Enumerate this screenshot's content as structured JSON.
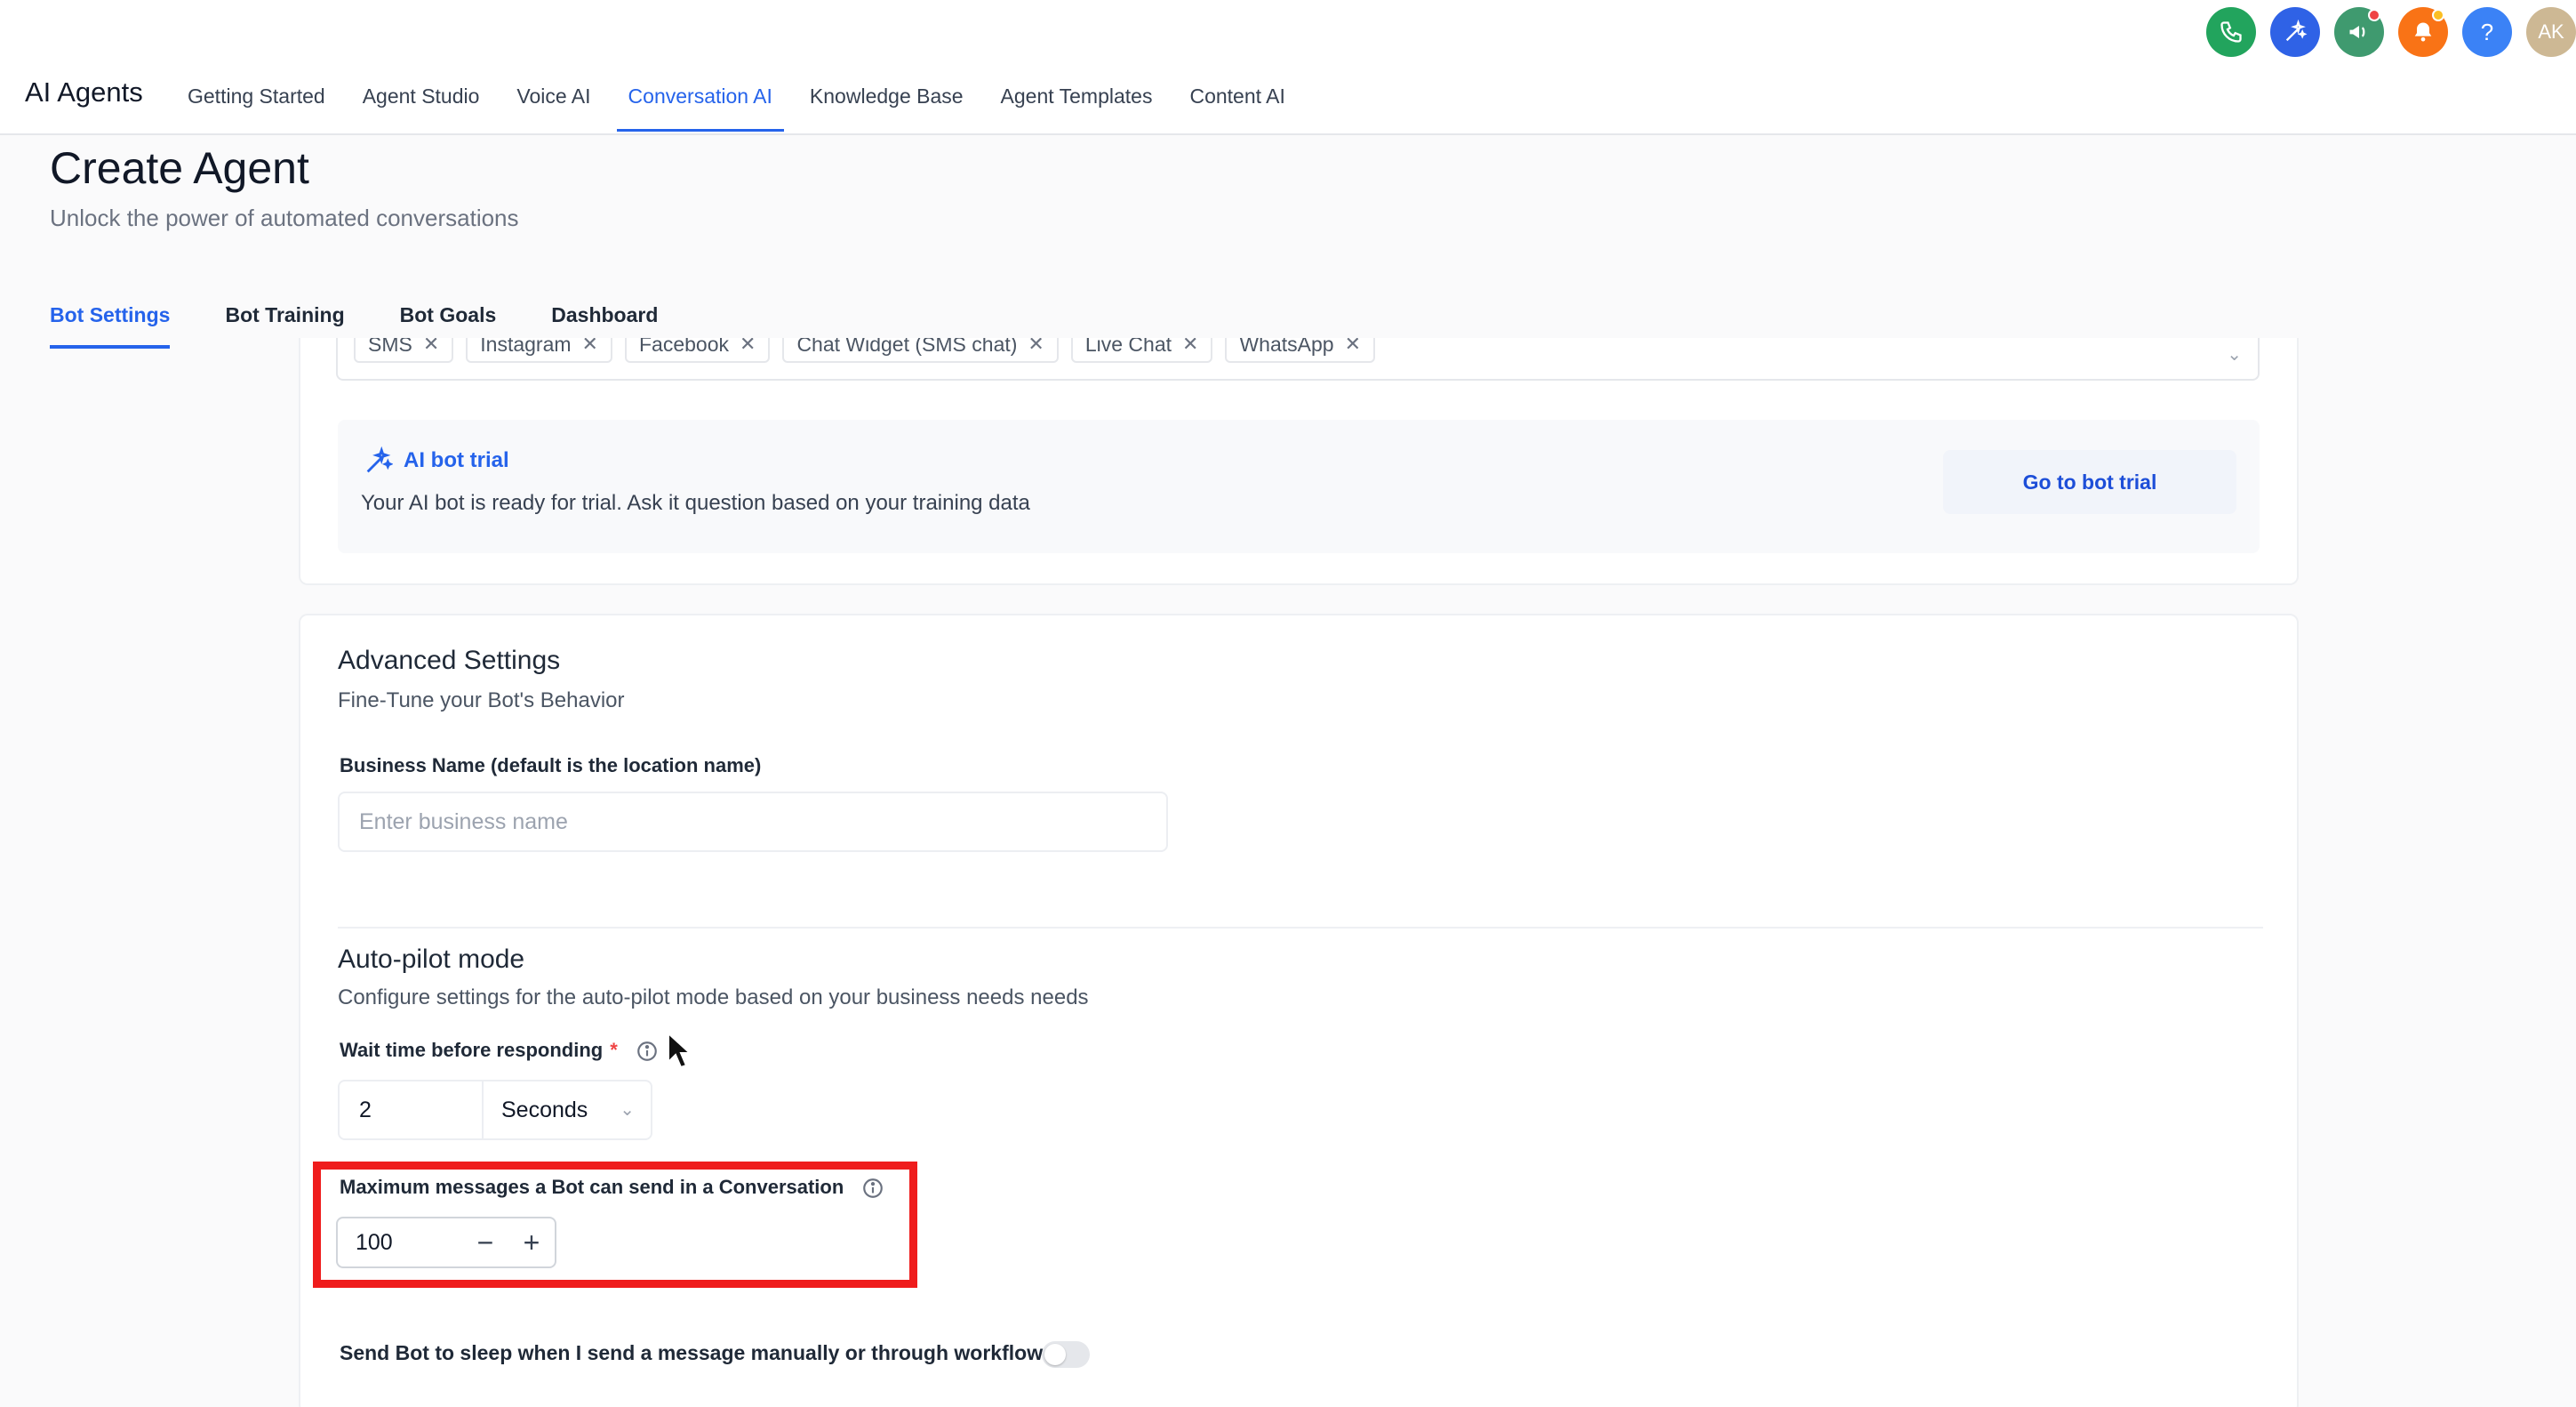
{
  "app": {
    "title": "AI Agents"
  },
  "nav": {
    "items": [
      {
        "label": "Getting Started"
      },
      {
        "label": "Agent Studio"
      },
      {
        "label": "Voice AI"
      },
      {
        "label": "Conversation AI"
      },
      {
        "label": "Knowledge Base"
      },
      {
        "label": "Agent Templates"
      },
      {
        "label": "Content AI"
      }
    ],
    "active": "Conversation AI"
  },
  "header_icons": {
    "phone": {
      "icon": "phone-icon",
      "color": "#22a45d"
    },
    "magic": {
      "icon": "sparkle-icon",
      "color": "#2f62e6"
    },
    "announce": {
      "icon": "megaphone-icon",
      "color": "#3f9a6f"
    },
    "bell": {
      "icon": "bell-icon",
      "color": "#f97316"
    },
    "help": {
      "icon": "help-icon",
      "label": "?",
      "color": "#3b82f6"
    },
    "avatar": {
      "initials": "AK",
      "color": "#cdb894"
    }
  },
  "page": {
    "title": "Create Agent",
    "subtitle": "Unlock the power of automated conversations"
  },
  "tabs": [
    {
      "label": "Bot Settings"
    },
    {
      "label": "Bot Training"
    },
    {
      "label": "Bot Goals"
    },
    {
      "label": "Dashboard"
    }
  ],
  "channels": [
    "SMS",
    "Instagram",
    "Facebook",
    "Chat Widget (SMS chat)",
    "Live Chat",
    "WhatsApp"
  ],
  "trial": {
    "title": "AI bot trial",
    "description": "Your AI bot is ready for trial. Ask it question based on your training data",
    "button": "Go to bot trial"
  },
  "advanced": {
    "title": "Advanced Settings",
    "subtitle": "Fine-Tune your Bot's Behavior",
    "business_label": "Business Name (default is the location name)",
    "business_placeholder": "Enter business name"
  },
  "autopilot": {
    "title": "Auto-pilot mode",
    "subtitle": "Configure settings for the auto-pilot mode based on your business needs needs",
    "wait_label": "Wait time before responding",
    "required_mark": "*",
    "wait_value": "2",
    "wait_unit": "Seconds",
    "max_label": "Maximum messages a Bot can send in a Conversation",
    "max_value": "100",
    "minus": "−",
    "plus": "+",
    "sleep_label": "Send Bot to sleep when I send a message manually or through workflow",
    "sleep_enabled": false
  },
  "colors": {
    "accent": "#2563eb",
    "highlight": "#ef1c1c"
  }
}
